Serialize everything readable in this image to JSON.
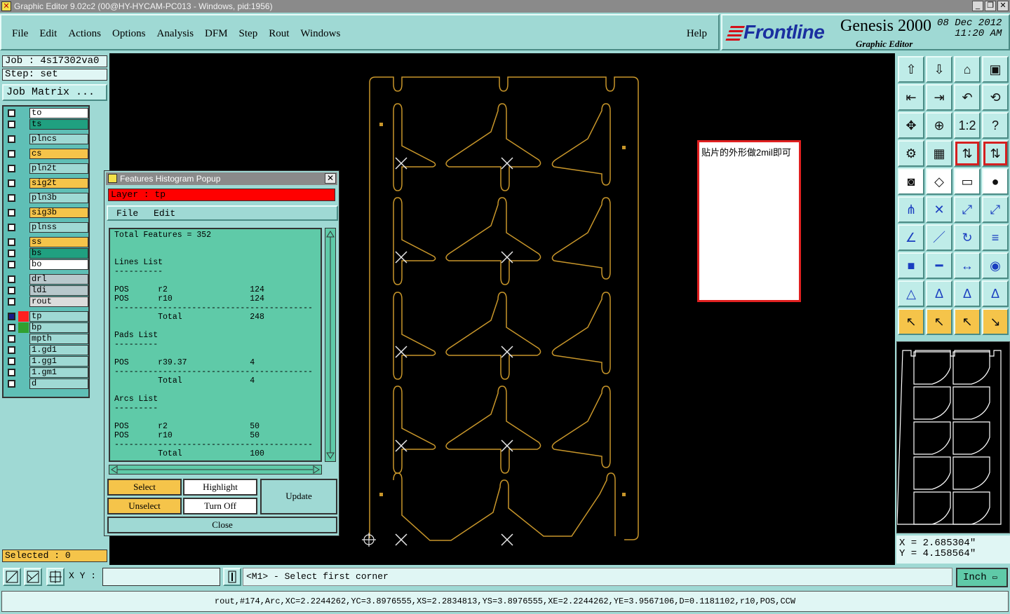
{
  "window": {
    "title": "Graphic Editor 9.02c2 (00@HY-HYCAM-PC013 - Windows, pid:1956)"
  },
  "menu": {
    "items": [
      "File",
      "Edit",
      "Actions",
      "Options",
      "Analysis",
      "DFM",
      "Step",
      "Rout",
      "Windows"
    ],
    "help": "Help"
  },
  "brand": {
    "logo": "Frontline",
    "product": "Genesis 2000",
    "subtitle": "Graphic Editor",
    "date": "08 Dec 2012",
    "time": "11:20 AM"
  },
  "job": {
    "job_label": "Job : 4s17302va0",
    "step_label": "Step: set",
    "matrix_button": "Job Matrix ..."
  },
  "layers": [
    {
      "name": "to",
      "color": "#ffffff",
      "swatch": ""
    },
    {
      "name": "ts",
      "color": "#20a080",
      "swatch": ""
    },
    {
      "name": "plncs",
      "color": "#9fd9d4",
      "swatch": ""
    },
    {
      "name": "cs",
      "color": "#f5c44a",
      "swatch": ""
    },
    {
      "name": "pln2t",
      "color": "#9fd9d4",
      "swatch": ""
    },
    {
      "name": "sig2t",
      "color": "#f5c44a",
      "swatch": ""
    },
    {
      "name": "pln3b",
      "color": "#9fd9d4",
      "swatch": ""
    },
    {
      "name": "sig3b",
      "color": "#f5c44a",
      "swatch": ""
    },
    {
      "name": "plnss",
      "color": "#9fd9d4",
      "swatch": ""
    },
    {
      "name": "ss",
      "color": "#f5c44a",
      "swatch": ""
    },
    {
      "name": "bs",
      "color": "#20a080",
      "swatch": ""
    },
    {
      "name": "bo",
      "color": "#ffffff",
      "swatch": ""
    },
    {
      "name": "drl",
      "color": "#b8c8cc",
      "swatch": ""
    },
    {
      "name": "ldi",
      "color": "#b8c8cc",
      "swatch": ""
    },
    {
      "name": "rout",
      "color": "#dcdcdc",
      "swatch": ""
    },
    {
      "name": "tp",
      "color": "#9fd9d4",
      "swatch": "#ff2020"
    },
    {
      "name": "bp",
      "color": "#9fd9d4",
      "swatch": "#30a030"
    },
    {
      "name": "mpth",
      "color": "#9fd9d4",
      "swatch": ""
    },
    {
      "name": "1.gd1",
      "color": "#9fd9d4",
      "swatch": ""
    },
    {
      "name": "1.gg1",
      "color": "#9fd9d4",
      "swatch": ""
    },
    {
      "name": "1.gm1",
      "color": "#9fd9d4",
      "swatch": ""
    },
    {
      "name": "d",
      "color": "#9fd9d4",
      "swatch": ""
    }
  ],
  "selected": "Selected : 0",
  "note": {
    "text": "贴片的外形做2mil即可"
  },
  "popup": {
    "title": "Features Histogram Popup",
    "layer": "Layer :  tp",
    "menu": [
      "File",
      "Edit"
    ],
    "report": "Total Features = 352\n\n\nLines List\n----------\n\nPOS      r2                 124\nPOS      r10                124\n-----------------------------------------\n         Total              248\n\nPads List\n---------\n\nPOS      r39.37             4\n-----------------------------------------\n         Total              4\n\nArcs List\n---------\n\nPOS      r2                 50\nPOS      r10                50\n-----------------------------------------\n         Total              100",
    "buttons": {
      "select": "Select",
      "unselect": "Unselect",
      "highlight": "Highlight",
      "turn_off": "Turn Off",
      "update": "Update",
      "close": "Close"
    }
  },
  "coords": {
    "x": "X = 2.685304\"",
    "y": "Y = 4.158564\""
  },
  "bottom": {
    "xy_label": "X Y :",
    "xy_value": "",
    "prompt": "<M1> - Select first corner",
    "unit": "Inch",
    "status": "rout,#174,Arc,XC=2.2244262,YC=3.8976555,XS=2.2834813,YS=3.8976555,XE=2.2244262,YE=3.9567106,D=0.1181102,r10,POS,CCW"
  },
  "toolbar": {
    "icons": [
      "home-icon",
      "save-icon",
      "house-icon",
      "window-icon",
      "pan-left-icon",
      "pan-right-icon",
      "undo-zoom-icon",
      "redraw-icon",
      "zoom-fit-icon",
      "zoom-center-icon",
      "zoom-1to1-icon",
      "help-icon",
      "settings-icon",
      "grid-icon",
      "layers-icon",
      "layers-alt-icon",
      "snap-icon",
      "transform-icon",
      "measure-icon",
      "select-pad-icon",
      "nodes-icon",
      "cross-icon",
      "connect-icon",
      "connect-alt-icon",
      "angle-icon",
      "line-icon",
      "arc-icon",
      "text-icon",
      "pad-icon",
      "segment-icon",
      "dimension-icon",
      "shape-icon",
      "triangle-icon",
      "delta-icon",
      "delta-alt-icon",
      "delta-red-icon",
      "pointer-icon",
      "pointer-box-icon",
      "pointer-select-icon",
      "pointer-path-icon"
    ]
  }
}
